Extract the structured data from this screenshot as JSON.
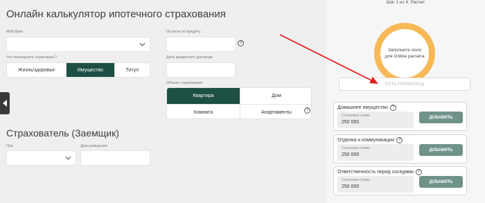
{
  "title": "Онлайн калькулятор ипотечного страхования",
  "form": {
    "bank_label": "Мой банк",
    "bank_value": "",
    "balance_label": "Остаток по кредиту",
    "balance_value": "",
    "insure_label": "Что планируете страховать?",
    "insure_options": [
      "Жизнь/здоровье",
      "Имущество",
      "Титул"
    ],
    "insure_selected": "Имущество",
    "contract_date_label": "Дата кредитного договора",
    "contract_date_value": "",
    "object_label": "Объект страхования",
    "object_options": [
      "Квартира",
      "Дом",
      "Комната",
      "Апартаменты"
    ],
    "object_selected": "Квартира"
  },
  "insured": {
    "title": "Страхователь (Заемщик)",
    "gender_label": "Пол",
    "gender_value": "",
    "birth_label": "Дата рождения",
    "birth_value": ""
  },
  "side": {
    "step": "Шаг 1 из 4: Расчет",
    "ring_text": "Заполните поля для Online расчета",
    "promo": "ЕСТЬ ПРОМОКОД",
    "cards": [
      {
        "title": "Домашнее имущество",
        "sum_label": "Страховая сумма",
        "sum_value": "250 000",
        "button": "ДОБАВИТЬ"
      },
      {
        "title": "Отделка и коммуникации",
        "sum_label": "Страховая сумма",
        "sum_value": "250 000",
        "button": "ДОБАВИТЬ"
      },
      {
        "title": "Ответственность перед соседями",
        "sum_label": "Страховая сумма",
        "sum_value": "250 000",
        "button": "ДОБАВИТЬ"
      }
    ]
  },
  "colors": {
    "accent_dark": "#1d4f44",
    "button": "#6f9289",
    "ring": "#f7b955",
    "annotation_arrow": "#e02020"
  },
  "icons": {
    "help": "question-circle-icon",
    "left_arrow": "arrow-left-icon",
    "right_arrow": "arrow-right-icon",
    "dropdown": "chevron-down-icon"
  }
}
